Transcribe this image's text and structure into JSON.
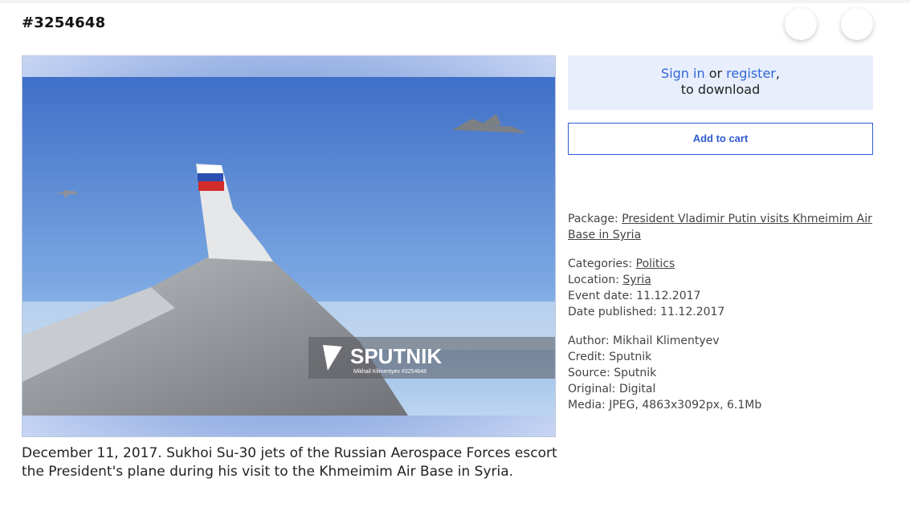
{
  "media_id": "#3254648",
  "signin": {
    "sign_in_label": "Sign in",
    "or_text": " or ",
    "register_label": "register",
    "comma": ",",
    "download_text": "to download"
  },
  "cart": {
    "label": "Add to cart"
  },
  "photo": {
    "watermark_brand": "SPUTNIK",
    "watermark_credit": "Mikhail Klimentyev #3254648"
  },
  "caption": "December 11, 2017. Sukhoi Su-30 jets of the Russian Aerospace Forces escort the President's plane during his visit to the Khmeimim Air Base in Syria.",
  "meta": {
    "package_label": "Package: ",
    "package_value": "President Vladimir Putin visits Khmeimim Air Base in Syria",
    "categories_label": "Categories: ",
    "categories_value": "Politics",
    "location_label": "Location: ",
    "location_value": "Syria",
    "event_date": "Event date: 11.12.2017",
    "date_published": "Date published: 11.12.2017",
    "author": "Author: Mikhail Klimentyev",
    "credit": "Credit: Sputnik",
    "source": "Source: Sputnik",
    "original": "Original: Digital",
    "media": "Media: JPEG, 4863x3092px, 6.1Mb"
  },
  "colors": {
    "link": "#2f66d8",
    "accent": "#2f5bd0",
    "signin_bg": "#e8eefb"
  }
}
